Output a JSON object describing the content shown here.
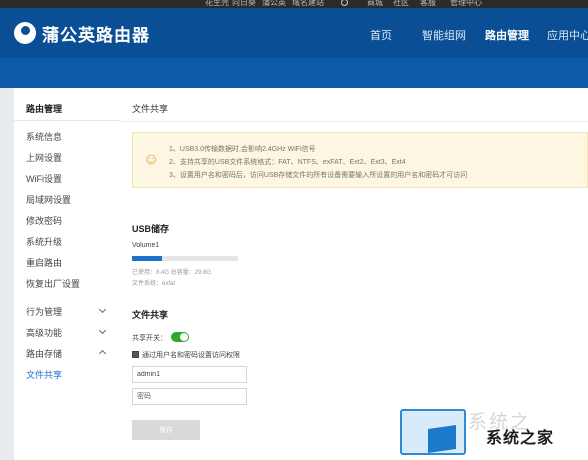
{
  "topbar": {
    "links": [
      "花生壳",
      "向日葵",
      "蒲公英",
      "域名建站",
      "商城",
      "社区",
      "客服",
      "管理中心"
    ]
  },
  "header": {
    "brand": "蒲公英路由器",
    "nav": [
      "首页",
      "智能组网",
      "路由管理",
      "应用中心"
    ],
    "active_nav": "路由管理"
  },
  "sidebar": {
    "title": "路由管理",
    "items": [
      "系统信息",
      "上网设置",
      "WiFi设置",
      "局域网设置",
      "修改密码",
      "系统升级",
      "重启路由",
      "恢复出厂设置"
    ],
    "groups": [
      {
        "label": "行为管理",
        "expanded": false
      },
      {
        "label": "高级功能",
        "expanded": false
      },
      {
        "label": "路由存储",
        "expanded": true
      }
    ],
    "active_item": "文件共享"
  },
  "main": {
    "title": "文件共享",
    "tips": [
      "1、USB3.0传输数据时,会影响2.4GHz WiFi信号",
      "2、支持共享的USB文件系统格式：FAT、NTFS、exFAT、Ext2、Ext3、Ext4",
      "3、设置用户名和密码后，访问USB存储文件的所有设备需要输入所设置的用户名和密码才可访问"
    ],
    "usb": {
      "section_title": "USB储存",
      "volume": "Volume1",
      "usage": "已使用：8.4G 总容量：29.8G",
      "used_fraction": 0.28,
      "filesystem": "文件系统：exfat"
    },
    "share": {
      "section_title": "文件共享",
      "toggle_label": "共享开关：",
      "toggle_on": true,
      "checkbox_label": "通过用户名和密码设置访问权限",
      "checkbox_checked": true,
      "username": "admin1",
      "password_placeholder": "密码",
      "save_label": "保存"
    }
  },
  "watermark": {
    "text": "系统之家"
  },
  "colors": {
    "header_bg": "#0a4f96",
    "accent": "#1a73c8",
    "toggle_on": "#2ea82e",
    "tips_bg": "#fdf7e1"
  }
}
